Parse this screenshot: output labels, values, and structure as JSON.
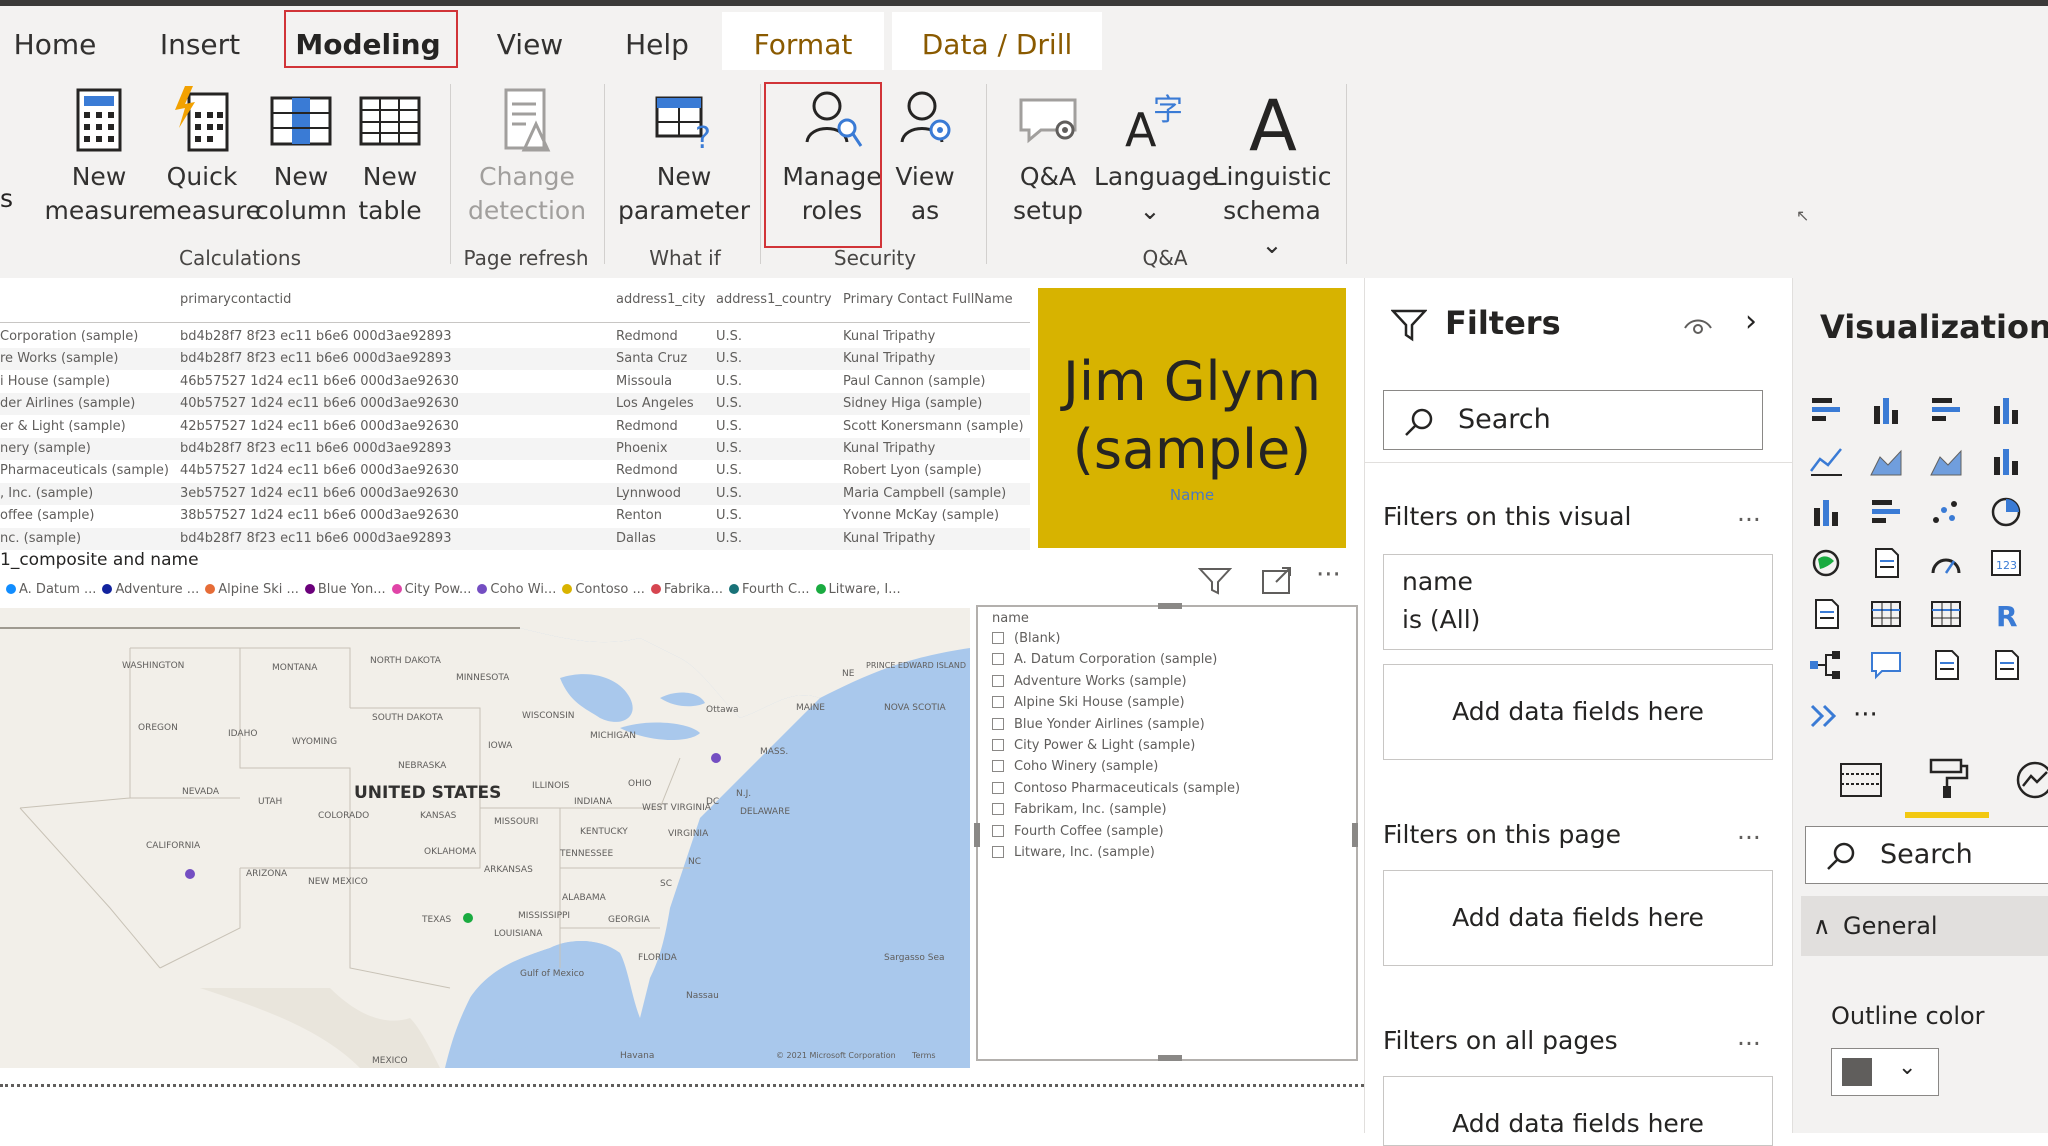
{
  "tabs": [
    {
      "label": "Home"
    },
    {
      "label": "Insert"
    },
    {
      "label": "Modeling"
    },
    {
      "label": "View"
    },
    {
      "label": "Help"
    },
    {
      "label": "Format"
    },
    {
      "label": "Data / Drill"
    }
  ],
  "ribbon": {
    "new_measure": {
      "l1": "New",
      "l2": "measure"
    },
    "quick_measure": {
      "l1": "Quick",
      "l2": "measure"
    },
    "new_column": {
      "l1": "New",
      "l2": "column"
    },
    "new_table": {
      "l1": "New",
      "l2": "table"
    },
    "change_detection": {
      "l1": "Change",
      "l2": "detection"
    },
    "new_parameter": {
      "l1": "New",
      "l2": "parameter"
    },
    "manage_roles": {
      "l1": "Manage",
      "l2": "roles"
    },
    "view_as": {
      "l1": "View",
      "l2": "as"
    },
    "qa_setup": {
      "l1": "Q&A",
      "l2": "setup"
    },
    "language": {
      "l1": "Language",
      "l2": "⌄"
    },
    "linguistic_schema": {
      "l1": "Linguistic",
      "l2": "schema ⌄"
    },
    "groups": {
      "calculations": "Calculations",
      "page_refresh": "Page refresh",
      "what_if": "What if",
      "security": "Security",
      "qa": "Q&A"
    }
  },
  "table": {
    "headers": {
      "contact": "primarycontactid",
      "city": "address1_city",
      "country": "address1_country",
      "fullname": "Primary Contact FullName"
    },
    "rows": [
      {
        "name": "Corporation (sample)",
        "contact": "bd4b28f7 8f23 ec11 b6e6 000d3ae92893",
        "city": "Redmond",
        "country": "U.S.",
        "fullname": "Kunal Tripathy"
      },
      {
        "name": "re Works (sample)",
        "contact": "bd4b28f7 8f23 ec11 b6e6 000d3ae92893",
        "city": "Santa Cruz",
        "country": "U.S.",
        "fullname": "Kunal Tripathy"
      },
      {
        "name": "i House (sample)",
        "contact": "46b57527 1d24 ec11 b6e6 000d3ae92630",
        "city": "Missoula",
        "country": "U.S.",
        "fullname": "Paul Cannon (sample)"
      },
      {
        "name": "der Airlines (sample)",
        "contact": "40b57527 1d24 ec11 b6e6 000d3ae92630",
        "city": "Los Angeles",
        "country": "U.S.",
        "fullname": "Sidney Higa (sample)"
      },
      {
        "name": "er & Light (sample)",
        "contact": "42b57527 1d24 ec11 b6e6 000d3ae92630",
        "city": "Redmond",
        "country": "U.S.",
        "fullname": "Scott Konersmann (sample)"
      },
      {
        "name": "nery (sample)",
        "contact": "bd4b28f7 8f23 ec11 b6e6 000d3ae92893",
        "city": "Phoenix",
        "country": "U.S.",
        "fullname": "Kunal Tripathy"
      },
      {
        "name": "Pharmaceuticals (sample)",
        "contact": "44b57527 1d24 ec11 b6e6 000d3ae92630",
        "city": "Redmond",
        "country": "U.S.",
        "fullname": "Robert Lyon (sample)"
      },
      {
        "name": ", Inc. (sample)",
        "contact": "3eb57527 1d24 ec11 b6e6 000d3ae92630",
        "city": "Lynnwood",
        "country": "U.S.",
        "fullname": "Maria Campbell (sample)"
      },
      {
        "name": "offee (sample)",
        "contact": "38b57527 1d24 ec11 b6e6 000d3ae92630",
        "city": "Renton",
        "country": "U.S.",
        "fullname": "Yvonne McKay (sample)"
      },
      {
        "name": "nc. (sample)",
        "contact": "bd4b28f7 8f23 ec11 b6e6 000d3ae92893",
        "city": "Dallas",
        "country": "U.S.",
        "fullname": "Kunal Tripathy"
      }
    ]
  },
  "card": {
    "value_line1": "Jim Glynn",
    "value_line2": "(sample)",
    "label": "Name"
  },
  "map": {
    "title": "1_composite and name",
    "legend": [
      {
        "label": "A. Datum ...",
        "color": "#118dff"
      },
      {
        "label": "Adventure ...",
        "color": "#12239e"
      },
      {
        "label": "Alpine Ski ...",
        "color": "#e66c37"
      },
      {
        "label": "Blue Yon...",
        "color": "#6b007b"
      },
      {
        "label": "City Pow...",
        "color": "#e044a7"
      },
      {
        "label": "Coho Wi...",
        "color": "#744ec2"
      },
      {
        "label": "Contoso ...",
        "color": "#d9b300"
      },
      {
        "label": "Fabrika...",
        "color": "#d64550"
      },
      {
        "label": "Fourth C...",
        "color": "#197278"
      },
      {
        "label": "Litware, I...",
        "color": "#1aab40"
      }
    ],
    "labels": {
      "us": "UNITED STATES",
      "washington": "WASHINGTON",
      "montana": "MONTANA",
      "north_dakota": "NORTH DAKOTA",
      "minnesota": "MINNESOTA",
      "oregon": "OREGON",
      "idaho": "IDAHO",
      "wyoming": "WYOMING",
      "south_dakota": "SOUTH DAKOTA",
      "wisconsin": "WISCONSIN",
      "michigan": "MICHIGAN",
      "iowa": "IOWA",
      "nebraska": "NEBRASKA",
      "nevada": "NEVADA",
      "utah": "UTAH",
      "colorado": "COLORADO",
      "kansas": "KANSAS",
      "illinois": "ILLINOIS",
      "indiana": "INDIANA",
      "ohio": "OHIO",
      "california": "CALIFORNIA",
      "missouri": "MISSOURI",
      "kentucky": "KENTUCKY",
      "virginia": "VIRGINIA",
      "west_virginia": "WEST VIRGINIA",
      "oklahoma": "OKLAHOMA",
      "tennessee": "TENNESSEE",
      "nc": "NC",
      "arizona": "ARIZONA",
      "new_mexico": "NEW MEXICO",
      "arkansas": "ARKANSAS",
      "sc": "SC",
      "texas": "TEXAS",
      "mississippi": "MISSISSIPPI",
      "alabama": "ALABAMA",
      "georgia": "GEORGIA",
      "louisiana": "LOUISIANA",
      "florida": "FLORIDA",
      "mexico": "MEXICO",
      "gulf": "Gulf of Mexico",
      "sargasso": "Sargasso Sea",
      "nassau": "Nassau",
      "havana": "Havana",
      "ottawa": "Ottawa",
      "maine": "MAINE",
      "mass": "MASS.",
      "nj": "N.J.",
      "dc": "DC",
      "delaware": "DELAWARE",
      "ne": "NE",
      "pei": "PRINCE EDWARD ISLAND",
      "nova_scotia": "NOVA SCOTIA",
      "copyright": "© 2021 Microsoft Corporation",
      "terms": "Terms"
    }
  },
  "slicer": {
    "header": "name",
    "items": [
      "(Blank)",
      "A. Datum Corporation (sample)",
      "Adventure Works (sample)",
      "Alpine Ski House (sample)",
      "Blue Yonder Airlines (sample)",
      "City Power & Light (sample)",
      "Coho Winery (sample)",
      "Contoso Pharmaceuticals (sample)",
      "Fabrikam, Inc. (sample)",
      "Fourth Coffee (sample)",
      "Litware, Inc. (sample)"
    ]
  },
  "filters": {
    "title": "Filters",
    "search_placeholder": "Search",
    "on_visual": "Filters on this visual",
    "visual_filter_field": "name",
    "visual_filter_value": "is (All)",
    "add_fields": "Add data fields here",
    "on_page": "Filters on this page",
    "on_all_pages": "Filters on all pages",
    "more": "..."
  },
  "visualizations": {
    "title": "Visualizations",
    "search_placeholder": "Search",
    "general": "General",
    "outline_color_label": "Outline color",
    "outline_color": "#605e5c",
    "r_label": "R",
    "more": "···"
  },
  "colors": {
    "accent_red": "#d13438",
    "card_bg": "#d7b300",
    "format_underline": "#f2c811"
  }
}
